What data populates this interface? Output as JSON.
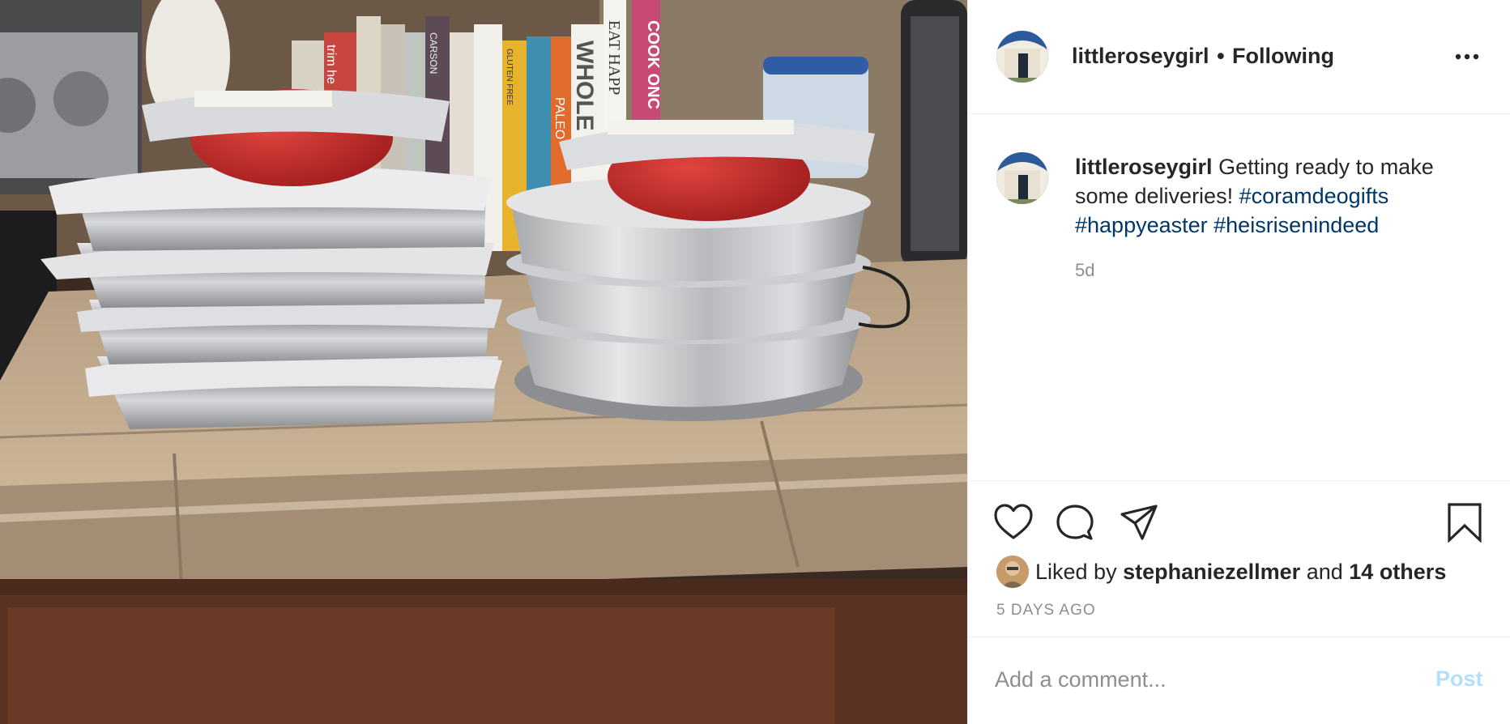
{
  "header": {
    "username": "littleroseygirl",
    "separator": "•",
    "follow_status": "Following",
    "more_icon": "more-options-icon"
  },
  "caption": {
    "username": "littleroseygirl",
    "text": "Getting ready to make some deliveries!",
    "hashtags": [
      "#coramdeogifts",
      "#happyeaster",
      "#heisrisenindeed"
    ],
    "age": "5d"
  },
  "photo": {
    "book_spines": [
      "trim he",
      "COOK ONC",
      "EAT HAPP",
      "WHOLE",
      "CARSON",
      "PALEO",
      "GLUTEN FREE"
    ]
  },
  "actions": {
    "icons": [
      "heart-icon",
      "comment-icon",
      "share-icon",
      "bookmark-icon"
    ]
  },
  "likes": {
    "prefix": "Liked by",
    "user": "stephaniezellmer",
    "conj": "and",
    "others": "14 others"
  },
  "timestamp": "5 DAYS AGO",
  "comment": {
    "placeholder": "Add a comment...",
    "post_label": "Post"
  },
  "colors": {
    "hashtag": "#00376b",
    "post_disabled": "#b2dffc",
    "muted": "#8e8e8e",
    "text": "#262626"
  }
}
